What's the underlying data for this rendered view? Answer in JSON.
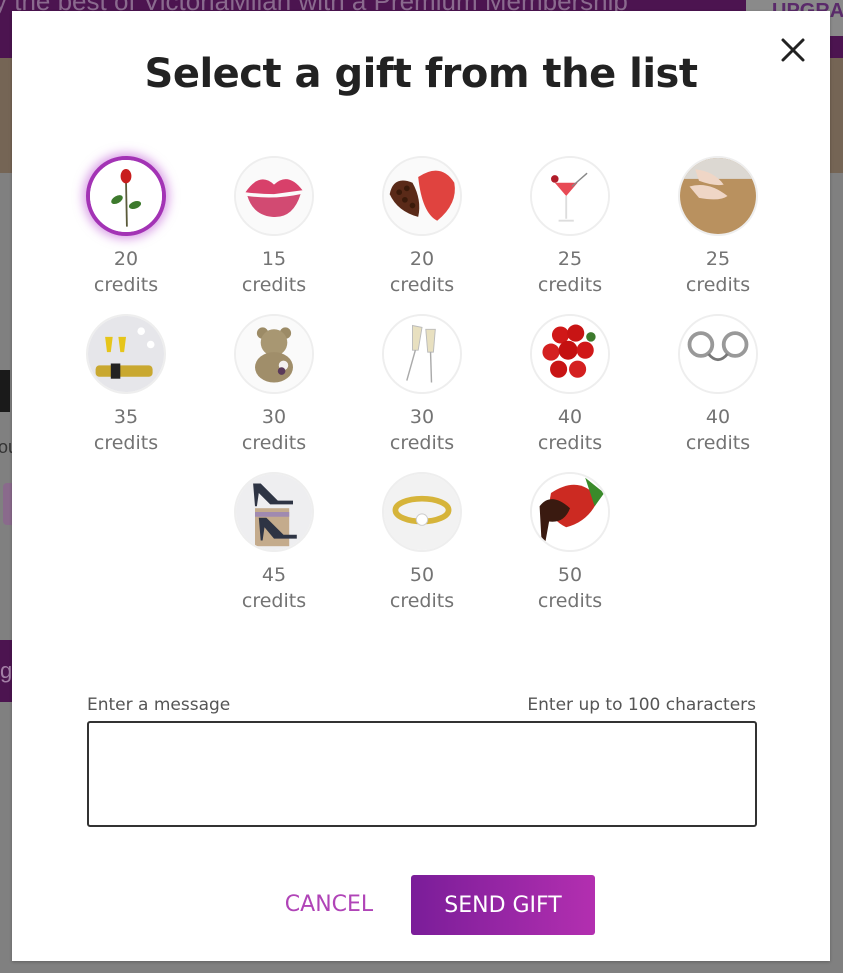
{
  "background": {
    "banner_text": "y the best of VictoriaMilan with a Premium Membership",
    "upgrade_label": "UPGRADE",
    "text_fragment": "ou",
    "button_fragment": "g"
  },
  "modal": {
    "title": "Select a gift from the list",
    "close_icon": "close-icon",
    "gifts": [
      {
        "name": "single-rose",
        "credits": "20",
        "unit": "credits",
        "selected": true
      },
      {
        "name": "kiss",
        "credits": "15",
        "unit": "credits",
        "selected": false
      },
      {
        "name": "chocolate-box",
        "credits": "20",
        "unit": "credits",
        "selected": false
      },
      {
        "name": "cocktail",
        "credits": "25",
        "unit": "credits",
        "selected": false
      },
      {
        "name": "massage",
        "credits": "25",
        "unit": "credits",
        "selected": false
      },
      {
        "name": "champagne-celebration",
        "credits": "35",
        "unit": "credits",
        "selected": false
      },
      {
        "name": "teddy-bear",
        "credits": "30",
        "unit": "credits",
        "selected": false
      },
      {
        "name": "champagne-toast",
        "credits": "30",
        "unit": "credits",
        "selected": false
      },
      {
        "name": "rose-bouquet",
        "credits": "40",
        "unit": "credits",
        "selected": false
      },
      {
        "name": "handcuffs",
        "credits": "40",
        "unit": "credits",
        "selected": false
      },
      {
        "name": "high-heels",
        "credits": "45",
        "unit": "credits",
        "selected": false
      },
      {
        "name": "diamond-ring",
        "credits": "50",
        "unit": "credits",
        "selected": false
      },
      {
        "name": "chocolate-strawberry",
        "credits": "50",
        "unit": "credits",
        "selected": false
      }
    ],
    "message": {
      "label": "Enter a message",
      "limit_hint": "Enter up to 100 characters",
      "value": "",
      "placeholder": ""
    },
    "cancel_label": "CANCEL",
    "send_label": "SEND GIFT"
  },
  "colors": {
    "accent": "#a333b5",
    "send_gradient_start": "#7a1d99",
    "send_gradient_end": "#b32fb0",
    "cancel_text": "#b044b7",
    "overlay": "#808080",
    "banner": "#4c1450"
  }
}
